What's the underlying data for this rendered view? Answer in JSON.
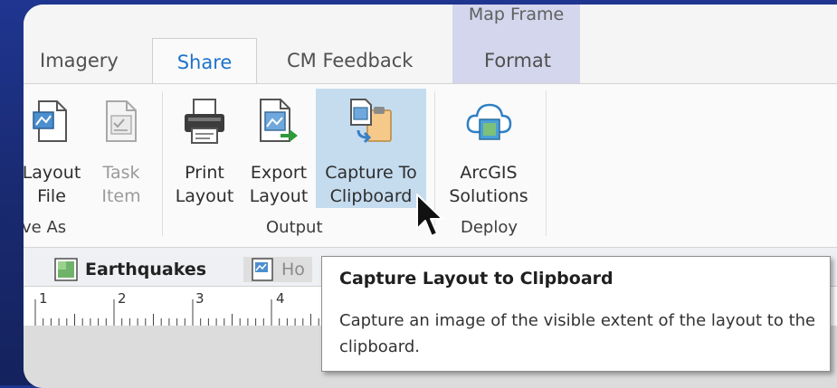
{
  "ribbon_tabs": {
    "imagery": "Imagery",
    "share": "Share",
    "cm_feedback": "CM Feedback",
    "format": "Format",
    "context_group": "Map Frame"
  },
  "ribbon": {
    "save_as": {
      "label": "ve As",
      "layout_file": [
        "Layout",
        "File"
      ],
      "task_item": [
        "Task",
        "Item"
      ]
    },
    "output": {
      "label": "Output",
      "print_layout": [
        "Print",
        "Layout"
      ],
      "export_layout": [
        "Export",
        "Layout"
      ],
      "capture_to_clipboard": [
        "Capture To",
        "Clipboard"
      ]
    },
    "deploy": {
      "label": "Deploy",
      "arcgis_solutions": [
        "ArcGIS",
        "Solutions"
      ]
    }
  },
  "view_tabs": [
    "Earthquakes",
    "Ho"
  ],
  "ruler": [
    "1",
    "2",
    "3",
    "4"
  ],
  "tooltip": {
    "title": "Capture Layout to Clipboard",
    "body": "Capture an image of the visible extent of the layout to the clipboard."
  },
  "colors": {
    "accent": "#1e73c9",
    "hover": "#c5dcef",
    "context_tab": "#d3d6ec",
    "background": "#1c2e7a"
  }
}
